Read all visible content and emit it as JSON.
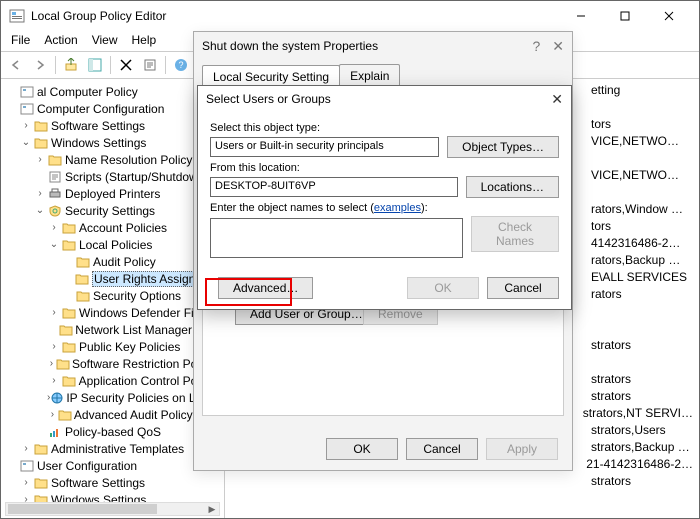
{
  "window": {
    "title": "Local Group Policy Editor",
    "menus": [
      "File",
      "Action",
      "View",
      "Help"
    ]
  },
  "tree": [
    {
      "depth": 0,
      "tw": "",
      "icon": "mmc",
      "label": "al Computer Policy"
    },
    {
      "depth": 0,
      "tw": "",
      "icon": "mmc",
      "label": "Computer Configuration"
    },
    {
      "depth": 1,
      "tw": ">",
      "icon": "folder",
      "label": "Software Settings"
    },
    {
      "depth": 1,
      "tw": "v",
      "icon": "folder",
      "label": "Windows Settings"
    },
    {
      "depth": 2,
      "tw": ">",
      "icon": "folder",
      "label": "Name Resolution Policy"
    },
    {
      "depth": 2,
      "tw": "",
      "icon": "script",
      "label": "Scripts (Startup/Shutdown)"
    },
    {
      "depth": 2,
      "tw": ">",
      "icon": "printer",
      "label": "Deployed Printers"
    },
    {
      "depth": 2,
      "tw": "v",
      "icon": "security",
      "label": "Security Settings"
    },
    {
      "depth": 3,
      "tw": ">",
      "icon": "folder",
      "label": "Account Policies"
    },
    {
      "depth": 3,
      "tw": "v",
      "icon": "folder",
      "label": "Local Policies"
    },
    {
      "depth": 4,
      "tw": "",
      "icon": "folder",
      "label": "Audit Policy"
    },
    {
      "depth": 4,
      "tw": "",
      "icon": "folder",
      "label": "User Rights Assignment",
      "selected": true
    },
    {
      "depth": 4,
      "tw": "",
      "icon": "folder",
      "label": "Security Options"
    },
    {
      "depth": 3,
      "tw": ">",
      "icon": "folder",
      "label": "Windows Defender Firew"
    },
    {
      "depth": 3,
      "tw": "",
      "icon": "folder",
      "label": "Network List Manager Polici"
    },
    {
      "depth": 3,
      "tw": ">",
      "icon": "folder",
      "label": "Public Key Policies"
    },
    {
      "depth": 3,
      "tw": ">",
      "icon": "folder",
      "label": "Software Restriction Policies"
    },
    {
      "depth": 3,
      "tw": ">",
      "icon": "folder",
      "label": "Application Control Policies"
    },
    {
      "depth": 3,
      "tw": ">",
      "icon": "ipsec",
      "label": "IP Security Policies on Local C"
    },
    {
      "depth": 3,
      "tw": ">",
      "icon": "folder",
      "label": "Advanced Audit Policy Confi"
    },
    {
      "depth": 2,
      "tw": "",
      "icon": "qos",
      "label": "Policy-based QoS"
    },
    {
      "depth": 1,
      "tw": ">",
      "icon": "folder",
      "label": "Administrative Templates"
    },
    {
      "depth": 0,
      "tw": "",
      "icon": "mmc",
      "label": "User Configuration"
    },
    {
      "depth": 1,
      "tw": ">",
      "icon": "folder",
      "label": "Software Settings"
    },
    {
      "depth": 1,
      "tw": ">",
      "icon": "folder",
      "label": "Windows Settings"
    }
  ],
  "rightList": [
    "etting",
    "",
    "tors",
    "VICE,NETWO…",
    "",
    "VICE,NETWO…",
    "",
    "rators,Window …",
    "tors",
    "4142316486-2…",
    "rators,Backup …",
    "E\\ALL SERVICES",
    "rators",
    "",
    "",
    "strators",
    "",
    "strators",
    "strators",
    "strators,NT SERVI…",
    "strators,Users",
    "strators,Backup …",
    "21-4142316486-2…",
    "strators"
  ],
  "properties_dialog": {
    "title": "Shut down the system Properties",
    "tab_active": "Local Security Setting",
    "tab_other": "Explain",
    "add_button": "Add User or Group…",
    "remove_button": "Remove",
    "ok": "OK",
    "cancel": "Cancel",
    "apply": "Apply"
  },
  "select_dialog": {
    "title": "Select Users or Groups",
    "obj_type_label": "Select this object type:",
    "obj_type_value": "Users or Built-in security principals",
    "obj_type_button": "Object Types…",
    "loc_label": "From this location:",
    "loc_value": "DESKTOP-8UIT6VP",
    "loc_button": "Locations…",
    "names_label_a": "Enter the object names to select (",
    "names_label_link": "examples",
    "names_label_b": "):",
    "names_value": "",
    "check_names": "Check Names",
    "advanced": "Advanced…",
    "ok": "OK",
    "cancel": "Cancel"
  }
}
